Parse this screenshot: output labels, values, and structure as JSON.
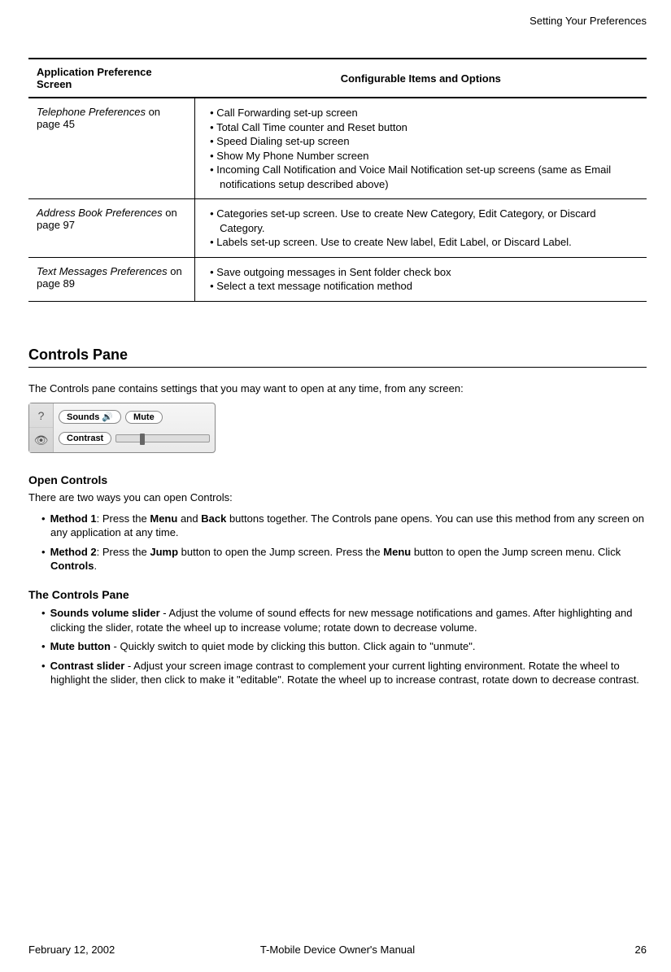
{
  "header": {
    "section": "Setting Your Preferences"
  },
  "table": {
    "headers": [
      "Application Preference Screen",
      "Configurable Items and Options"
    ],
    "rows": [
      {
        "title_italic": "Telephone Preferences",
        "title_rest": " on page 45",
        "items": [
          "Call Forwarding set-up screen",
          "Total Call Time counter and Reset button",
          "Speed Dialing set-up screen",
          "Show My Phone Number screen",
          "Incoming Call Notification and Voice Mail Notification set-up screens (same as Email notifications setup described above)"
        ]
      },
      {
        "title_italic": "Address Book Preferences",
        "title_rest": " on page 97",
        "items": [
          "Categories set-up screen. Use to create New Category, Edit Category, or Discard Category.",
          "Labels set-up screen. Use to create New label, Edit Label, or Discard Label."
        ]
      },
      {
        "title_italic": "Text Messages Preferences",
        "title_rest": " on page 89",
        "items": [
          "Save outgoing messages in Sent folder check box",
          "Select a text message notification method"
        ]
      }
    ]
  },
  "section1": {
    "title": "Controls Pane",
    "intro": "The Controls pane contains settings that you may want to open at any time, from any screen:"
  },
  "widget": {
    "sounds_label": "Sounds",
    "mute_label": "Mute",
    "contrast_label": "Contrast"
  },
  "open_controls": {
    "title": "Open Controls",
    "intro": "There are two ways you can open Controls:",
    "m1_a": "Method 1",
    "m1_b": ": Press the ",
    "m1_c": "Menu",
    "m1_d": " and ",
    "m1_e": "Back",
    "m1_f": " buttons together. The Controls pane opens. You can use this method from any screen on any application at any time.",
    "m2_a": "Method 2",
    "m2_b": ": Press the ",
    "m2_c": "Jump",
    "m2_d": " button to open the Jump screen. Press the ",
    "m2_e": "Menu",
    "m2_f": " button to open the Jump screen menu. Click ",
    "m2_g": "Controls",
    "m2_h": "."
  },
  "controls_pane": {
    "title": "The Controls Pane",
    "i1_a": "Sounds volume slider",
    "i1_b": " - Adjust the volume of sound effects for new message notifications and games. After highlighting and clicking the slider, rotate the wheel up to increase volume; rotate down to decrease volume.",
    "i2_a": "Mute button",
    "i2_b": " - Quickly switch to quiet mode by clicking this button. Click again to \"unmute\".",
    "i3_a": "Contrast slider",
    "i3_b": " - Adjust your screen image contrast to complement your current lighting environment. Rotate the wheel to highlight the slider, then click to make it \"editable\". Rotate the wheel up to increase contrast, rotate down to decrease contrast."
  },
  "footer": {
    "date": "February 12, 2002",
    "center": "T-Mobile Device Owner's Manual",
    "page": "26"
  }
}
